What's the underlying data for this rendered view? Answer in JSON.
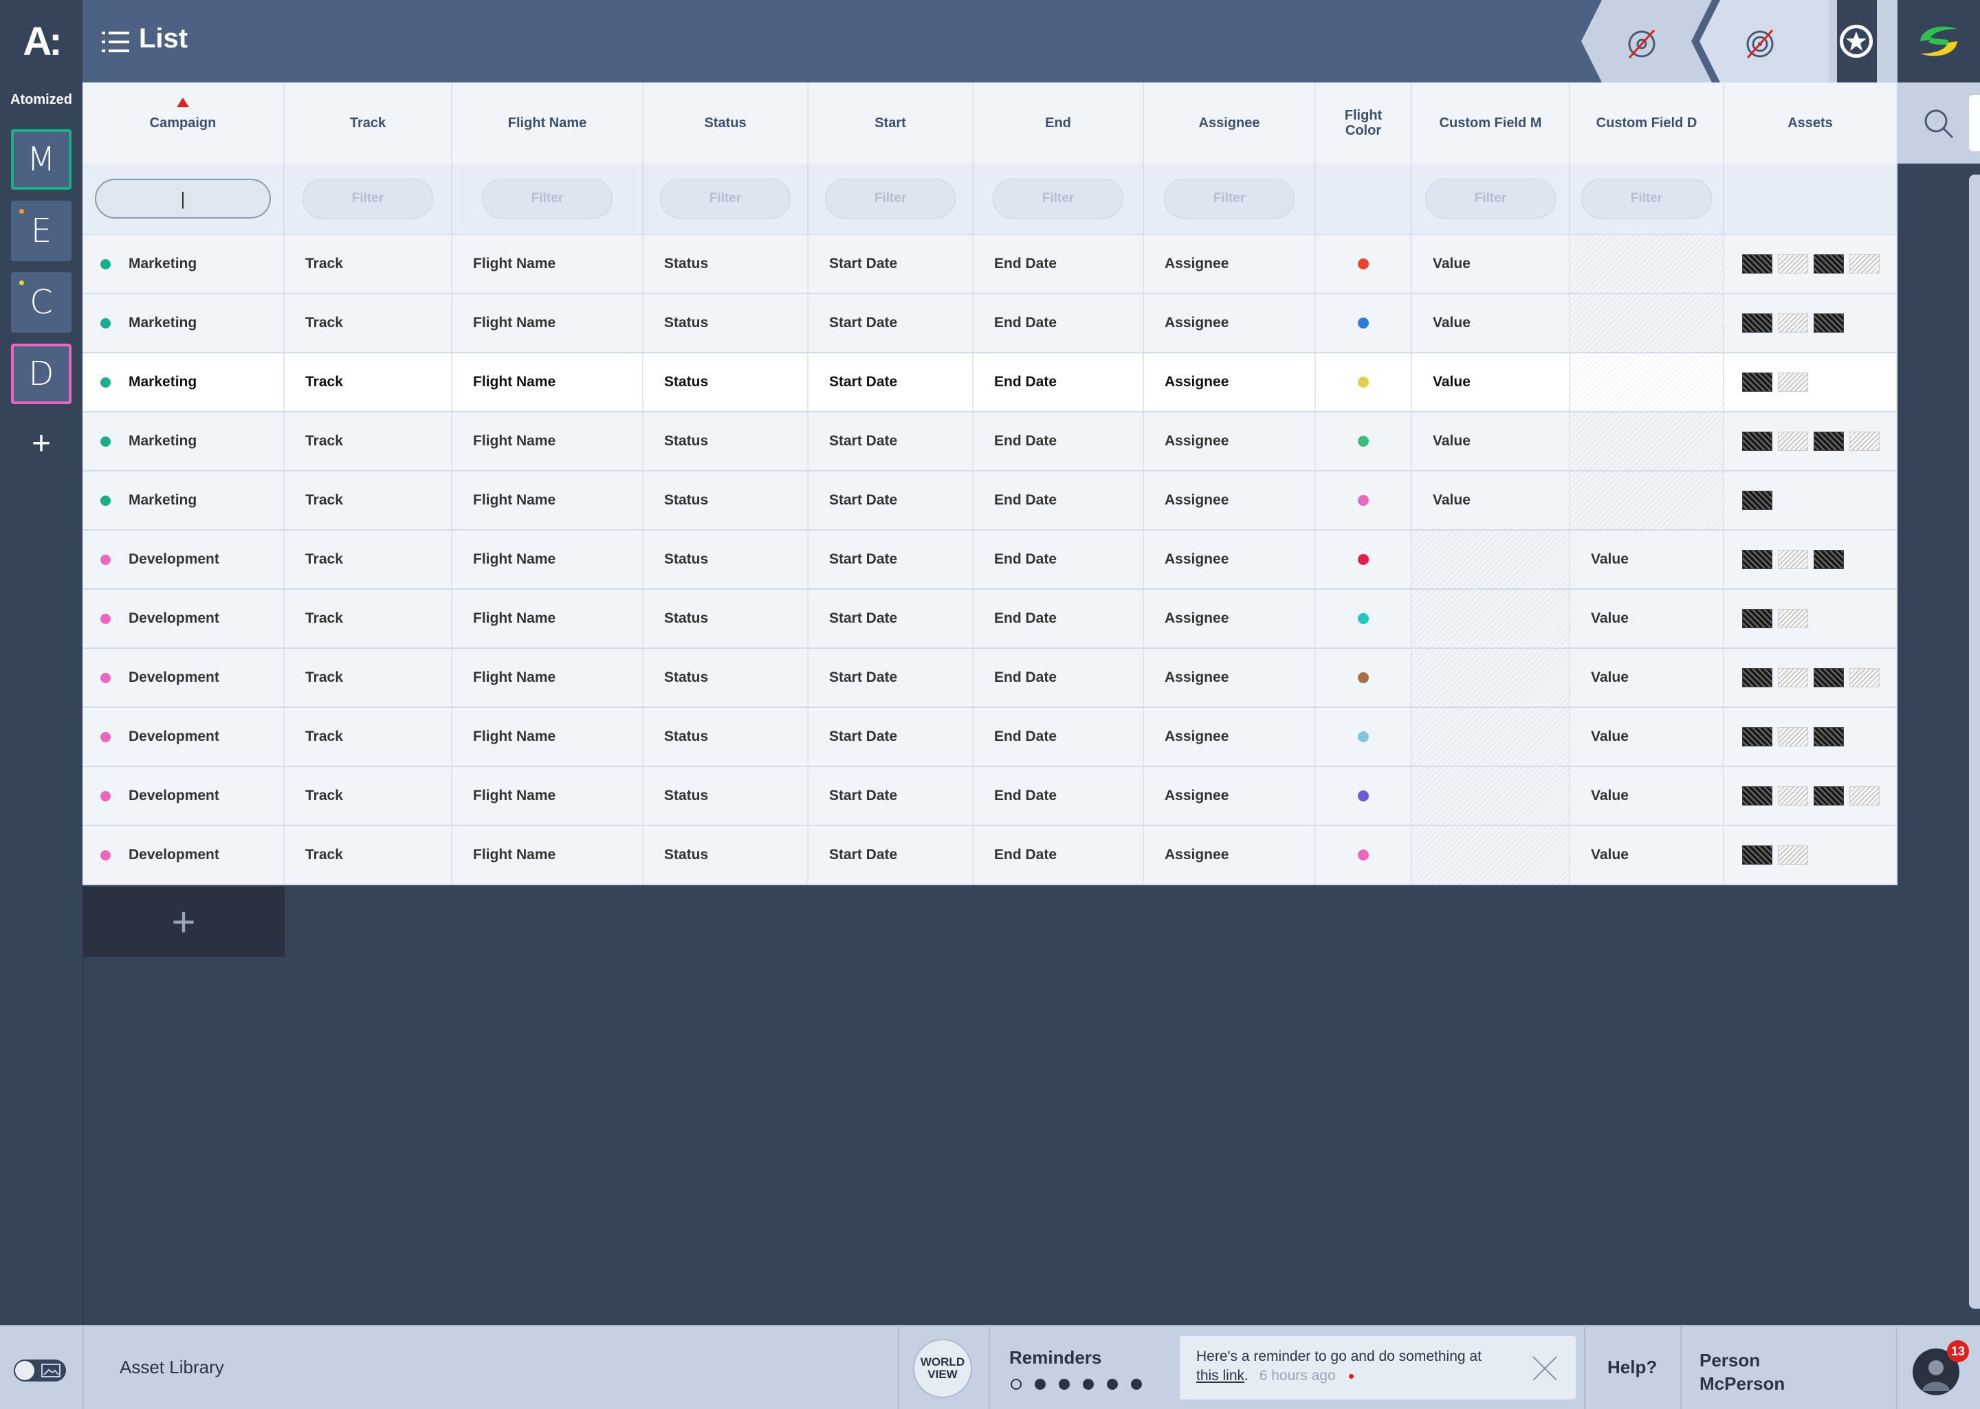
{
  "app": {
    "logo_text": "A:",
    "org_label": "Atomized",
    "view_title": "List"
  },
  "workspaces": [
    {
      "letter": "M",
      "border": "#1cae8a",
      "dot": ""
    },
    {
      "letter": "E",
      "border": "",
      "dot": "#f0a030"
    },
    {
      "letter": "C",
      "border": "",
      "dot": "#f0d040"
    },
    {
      "letter": "D",
      "border": "#e868c0",
      "dot": ""
    }
  ],
  "rail_add_label": "+",
  "columns": [
    "Campaign",
    "Track",
    "Flight Name",
    "Status",
    "Start",
    "End",
    "Assignee",
    "Flight\nColor",
    "Custom Field M",
    "Custom Field D",
    "Assets"
  ],
  "sort": {
    "column": "Campaign",
    "direction": "ascending"
  },
  "filter_placeholder": "Filter",
  "filter_active_value": "|",
  "rows": [
    {
      "campaign": "Marketing",
      "campaign_color": "#1cae8a",
      "track": "Track",
      "flight": "Flight Name",
      "status": "Status",
      "start": "Start Date",
      "end": "End Date",
      "assignee": "Assignee",
      "flight_color": "#e8432e",
      "field_m": "Value",
      "field_d": "",
      "assets": [
        "pattern",
        "light",
        "pattern",
        "light"
      ],
      "bold": false
    },
    {
      "campaign": "Marketing",
      "campaign_color": "#1cae8a",
      "track": "Track",
      "flight": "Flight Name",
      "status": "Status",
      "start": "Start Date",
      "end": "End Date",
      "assignee": "Assignee",
      "flight_color": "#2a7fd6",
      "field_m": "Value",
      "field_d": "",
      "assets": [
        "pattern",
        "light",
        "pattern"
      ],
      "bold": false
    },
    {
      "campaign": "Marketing",
      "campaign_color": "#1cae8a",
      "track": "Track",
      "flight": "Flight Name",
      "status": "Status",
      "start": "Start Date",
      "end": "End Date",
      "assignee": "Assignee",
      "flight_color": "#e0d050",
      "field_m": "Value",
      "field_d": "",
      "assets": [
        "pattern",
        "light"
      ],
      "bold": true
    },
    {
      "campaign": "Marketing",
      "campaign_color": "#1cae8a",
      "track": "Track",
      "flight": "Flight Name",
      "status": "Status",
      "start": "Start Date",
      "end": "End Date",
      "assignee": "Assignee",
      "flight_color": "#38c07a",
      "field_m": "Value",
      "field_d": "",
      "assets": [
        "pattern",
        "light",
        "pattern",
        "light"
      ],
      "bold": false
    },
    {
      "campaign": "Marketing",
      "campaign_color": "#1cae8a",
      "track": "Track",
      "flight": "Flight Name",
      "status": "Status",
      "start": "Start Date",
      "end": "End Date",
      "assignee": "Assignee",
      "flight_color": "#e868c0",
      "field_m": "Value",
      "field_d": "",
      "assets": [
        "pattern"
      ],
      "bold": false
    },
    {
      "campaign": "Development",
      "campaign_color": "#e868c0",
      "track": "Track",
      "flight": "Flight Name",
      "status": "Status",
      "start": "Start Date",
      "end": "End Date",
      "assignee": "Assignee",
      "flight_color": "#e0204a",
      "field_m": "",
      "field_d": "Value",
      "assets": [
        "pattern",
        "light",
        "pattern"
      ],
      "bold": false
    },
    {
      "campaign": "Development",
      "campaign_color": "#e868c0",
      "track": "Track",
      "flight": "Flight Name",
      "status": "Status",
      "start": "Start Date",
      "end": "End Date",
      "assignee": "Assignee",
      "flight_color": "#20c8c0",
      "field_m": "",
      "field_d": "Value",
      "assets": [
        "pattern",
        "light"
      ],
      "bold": false
    },
    {
      "campaign": "Development",
      "campaign_color": "#e868c0",
      "track": "Track",
      "flight": "Flight Name",
      "status": "Status",
      "start": "Start Date",
      "end": "End Date",
      "assignee": "Assignee",
      "flight_color": "#a8704a",
      "field_m": "",
      "field_d": "Value",
      "assets": [
        "pattern",
        "light",
        "pattern",
        "light"
      ],
      "bold": false
    },
    {
      "campaign": "Development",
      "campaign_color": "#e868c0",
      "track": "Track",
      "flight": "Flight Name",
      "status": "Status",
      "start": "Start Date",
      "end": "End Date",
      "assignee": "Assignee",
      "flight_color": "#88c4d8",
      "field_m": "",
      "field_d": "Value",
      "assets": [
        "pattern",
        "light",
        "pattern"
      ],
      "bold": false
    },
    {
      "campaign": "Development",
      "campaign_color": "#e868c0",
      "track": "Track",
      "flight": "Flight Name",
      "status": "Status",
      "start": "Start Date",
      "end": "End Date",
      "assignee": "Assignee",
      "flight_color": "#6a5ad8",
      "field_m": "",
      "field_d": "Value",
      "assets": [
        "pattern",
        "light",
        "pattern",
        "light"
      ],
      "bold": false
    },
    {
      "campaign": "Development",
      "campaign_color": "#e868c0",
      "track": "Track",
      "flight": "Flight Name",
      "status": "Status",
      "start": "Start Date",
      "end": "End Date",
      "assignee": "Assignee",
      "flight_color": "#e868c0",
      "field_m": "",
      "field_d": "Value",
      "assets": [
        "pattern",
        "light"
      ],
      "bold": false
    }
  ],
  "add_row_label": "+",
  "bottom": {
    "asset_library": "Asset Library",
    "world_view": "WORLD VIEW",
    "reminders_title": "Reminders",
    "reminder_dots": 6,
    "reminder_text_pre": "Here's a reminder to go and do something at ",
    "reminder_link": "this link",
    "reminder_text_post": ".",
    "reminder_time": "6 hours ago",
    "help": "Help?",
    "user_first": "Person",
    "user_last": "McPerson",
    "notifications": "13"
  },
  "colors": {
    "accent_red": "#e02020",
    "brand_green": "#2ec050",
    "brand_yellow": "#f0d020"
  }
}
